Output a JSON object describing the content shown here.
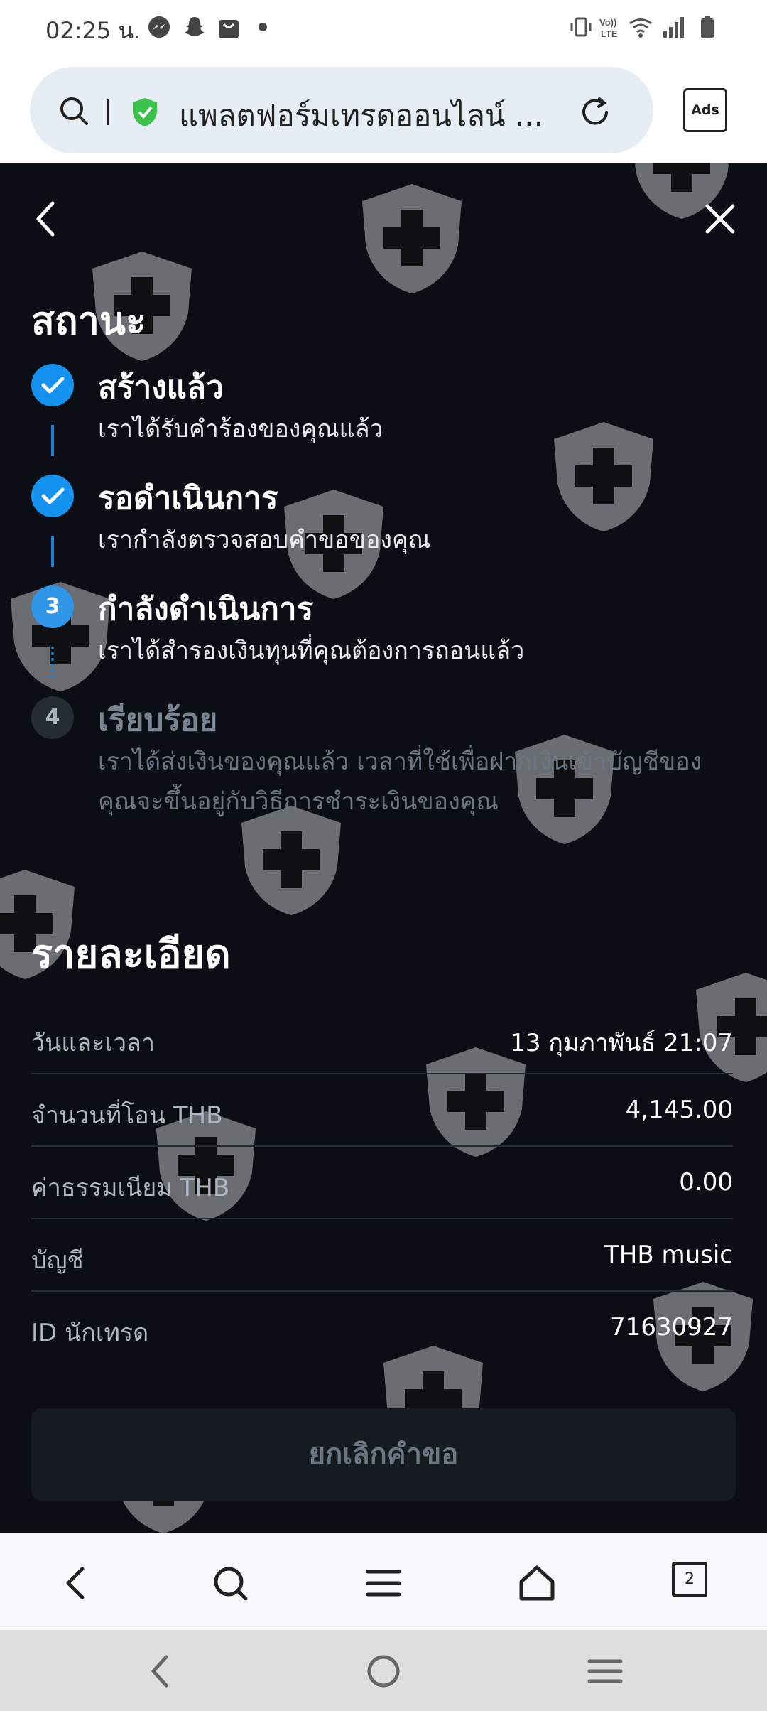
{
  "status_bar": {
    "time": "02:25 น.",
    "icons": [
      "messenger-icon",
      "snapchat-icon",
      "bag-icon",
      "vibrate-icon",
      "volte-icon",
      "wifi-icon",
      "signal-icon",
      "battery-icon"
    ]
  },
  "browser": {
    "url_title": "แพลตฟอร์มเทรดออนไลน์ ...",
    "ads_label": "Ads",
    "tab_count": "2"
  },
  "status_section": {
    "title": "สถานะ",
    "steps": [
      {
        "number": "",
        "label": "สร้างแล้ว",
        "desc": "เราได้รับคำร้องของคุณแล้ว",
        "state": "done"
      },
      {
        "number": "",
        "label": "รอดำเนินการ",
        "desc": "เรากำลังตรวจสอบคำขอของคุณ",
        "state": "done"
      },
      {
        "number": "3",
        "label": "กำลังดำเนินการ",
        "desc": "เราได้สำรองเงินทุนที่คุณต้องการถอนแล้ว",
        "state": "active"
      },
      {
        "number": "4",
        "label": "เรียบร้อย",
        "desc": "เราได้ส่งเงินของคุณแล้ว เวลาที่ใช้เพื่อฝากเงินเข้าบัญชีของคุณจะขึ้นอยู่กับวิธีการชำระเงินของคุณ",
        "state": "pending"
      }
    ]
  },
  "details": {
    "title": "รายละเอียด",
    "rows": [
      {
        "key": "วันและเวลา",
        "value": "13 กุมภาพันธ์ 21:07"
      },
      {
        "key": "จำนวนที่โอน THB",
        "value": "4,145.00"
      },
      {
        "key": "ค่าธรรมเนียม THB",
        "value": "0.00"
      },
      {
        "key": "บัญชี",
        "value": "THB music"
      },
      {
        "key": "ID นักเทรด",
        "value": "71630927"
      }
    ]
  },
  "cancel_button": "ยกเลิกคำขอ",
  "colors": {
    "background": "#0b0f15",
    "accent": "#1592f0",
    "shield_green": "#3ac24a"
  }
}
